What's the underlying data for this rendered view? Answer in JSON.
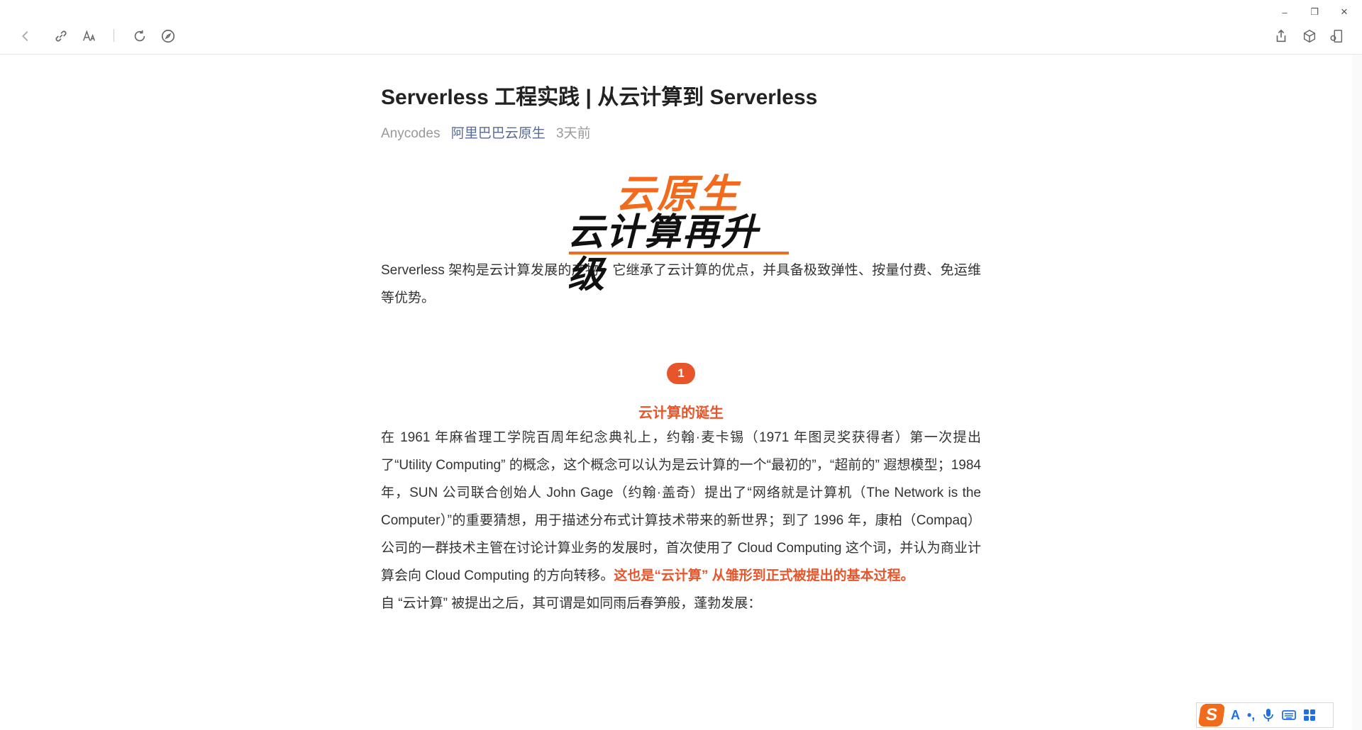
{
  "toolbar": {
    "back_icon": "chevron-left-icon",
    "link_icon": "link-icon",
    "font_icon": "font-size-icon",
    "refresh_icon": "refresh-icon",
    "compass_icon": "compass-icon",
    "share_icon": "share-icon",
    "cube_icon": "cube-icon",
    "window_icon": "open-window-icon"
  },
  "window_controls": {
    "minimize": "–",
    "restore": "❐",
    "close": "✕"
  },
  "article": {
    "title": "Serverless 工程实践 | 从云计算到 Serverless",
    "author": "Anycodes",
    "source": "阿里巴巴云原生",
    "time": "3天前",
    "banner_line1": "云原生",
    "banner_line2": "云计算再升级",
    "intro": "Serverless 架构是云计算发展的产物，它继承了云计算的优点，并具备极致弹性、按量付费、免运维等优势。",
    "section_number": "1",
    "section_title": "云计算的诞生",
    "para1": "在 1961 年麻省理工学院百周年纪念典礼上，约翰·麦卡锡（1971 年图灵奖获得者）第一次提出了“Utility Computing” 的概念，这个概念可以认为是云计算的一个“最初的”，“超前的” 遐想模型；1984 年，SUN 公司联合创始人 John Gage（约翰·盖奇）提出了“网络就是计算机（The Network is the Computer）”的重要猜想，用于描述分布式计算技术带来的新世界；到了 1996 年，康柏（Compaq）公司的一群技术主管在讨论计算业务的发展时，首次使用了 Cloud Computing 这个词，并认为商业计算会向 Cloud Computing 的方向转移。",
    "para1_highlight": "这也是“云计算” 从雏形到正式被提出的基本过程。",
    "para2": "自 “云计算” 被提出之后，其可谓是如同雨后春笋般，蓬勃发展："
  },
  "ime": {
    "logo": "S",
    "mode": "A",
    "punct": "•,",
    "mic_icon": "microphone-icon",
    "keyboard_icon": "keyboard-icon",
    "apps_icon": "grid-icon"
  },
  "colors": {
    "accent": "#e8552a",
    "link": "#576b95",
    "brand_orange": "#f26b1d"
  }
}
